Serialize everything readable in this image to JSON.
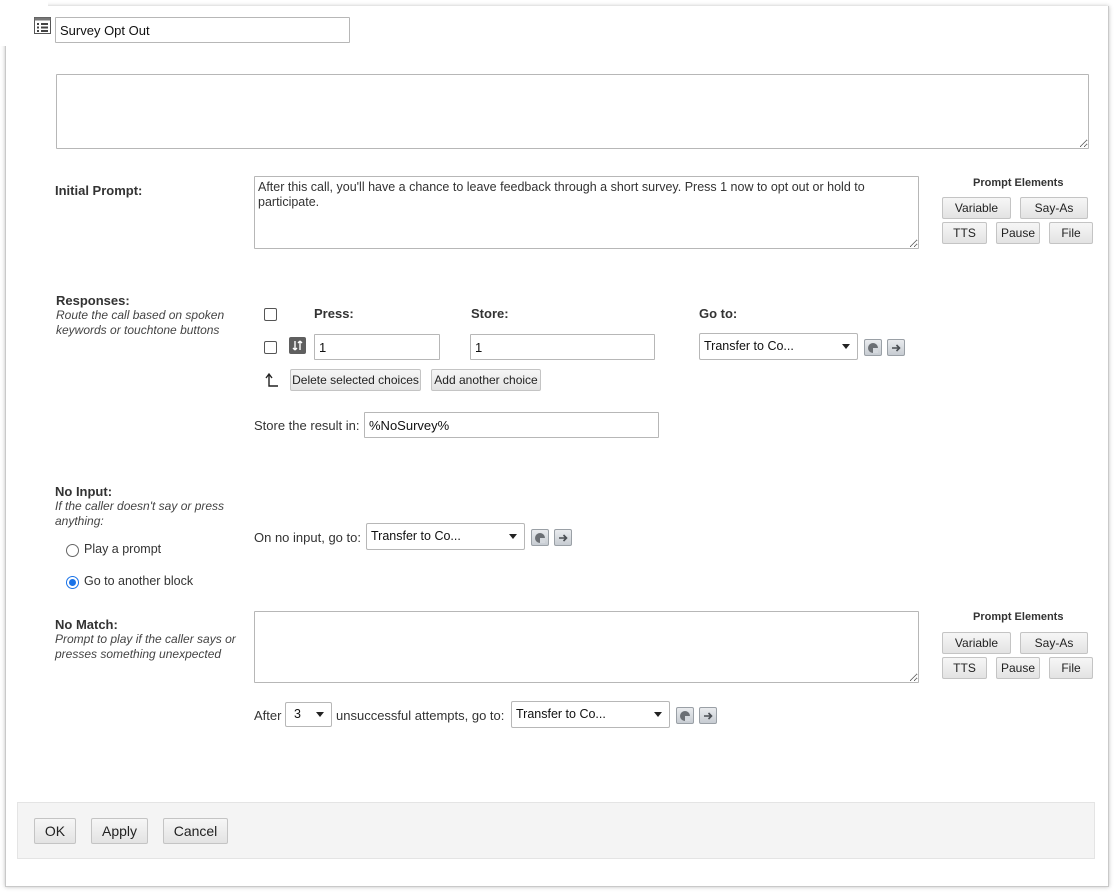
{
  "header": {
    "title_value": "Survey Opt Out",
    "block_icon": "list-icon"
  },
  "description": {
    "value": ""
  },
  "initial_prompt": {
    "label": "Initial Prompt:",
    "value": "After this call, you'll have a chance to leave feedback through a short survey. Press 1 now to opt out or hold to participate."
  },
  "prompt_elements": {
    "title": "Prompt Elements",
    "buttons": [
      "Variable",
      "Say-As",
      "TTS",
      "Pause",
      "File"
    ]
  },
  "responses": {
    "label": "Responses:",
    "desc": "Route the call based on spoken keywords or touchtone buttons",
    "col_press": "Press:",
    "col_store": "Store:",
    "col_goto": "Go to:",
    "rows": [
      {
        "press": "1",
        "store": "1",
        "goto": "Transfer to Co..."
      }
    ],
    "delete_btn": "Delete selected choices",
    "add_btn": "Add another choice",
    "store_label": "Store the result in:",
    "store_value": "%NoSurvey%"
  },
  "no_input": {
    "label": "No Input:",
    "desc": "If the caller doesn't say or press anything:",
    "option_prompt": "Play a prompt",
    "option_block": "Go to another block",
    "selected": "Go to another block",
    "goto_label": "On no input, go to:",
    "goto_value": "Transfer to Co..."
  },
  "no_match": {
    "label": "No Match:",
    "desc": "Prompt to play if the caller says or presses something unexpected",
    "value": "",
    "after_label": "After",
    "attempts": "3",
    "attempts_suffix": "unsuccessful attempts, go to:",
    "goto_value": "Transfer to Co..."
  },
  "footer": {
    "ok": "OK",
    "apply": "Apply",
    "cancel": "Cancel"
  },
  "colors": {
    "radio_selected": "#1a73e8"
  }
}
